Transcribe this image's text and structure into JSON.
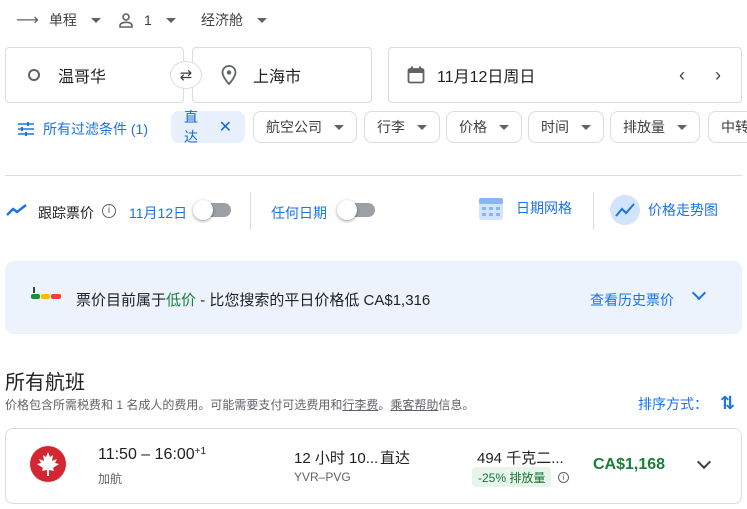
{
  "top_controls": {
    "trip_type": "单程",
    "passengers": "1",
    "cabin_class": "经济舱"
  },
  "search": {
    "origin": "温哥华",
    "destination": "上海市",
    "date": "11月12日周日"
  },
  "filters": {
    "all_filters": "所有过滤条件 (1)",
    "nonstop": "直达",
    "airlines": "航空公司",
    "bags": "行李",
    "price": "价格",
    "times": "时间",
    "emissions": "排放量",
    "overflow": "中转"
  },
  "tracking": {
    "label": "跟踪票价",
    "date": "11月12日",
    "any_dates": "任何日期",
    "date_grid": "日期网格",
    "price_graph": "价格走势图"
  },
  "price_insight": {
    "prefix": "票价目前属于",
    "level": "低价",
    "suffix": " - 比您搜索的平日价格低 CA$1,316",
    "history_link": "查看历史票价",
    "bar_colors": [
      "#1e8e3e",
      "#fbbc04",
      "#ea4335"
    ]
  },
  "results": {
    "heading": "所有航班",
    "note_part1": "价格包含所需税费和 1 名成人的费用。可能需要支付可选费用和",
    "note_link1": "行李费",
    "note_part2": "。",
    "note_link2": "乘客帮助",
    "note_part3": "信息。",
    "sort_label": "排序方式："
  },
  "flights": [
    {
      "times": "11:50 – 16:00",
      "day_offset": "+1",
      "airline": "加航",
      "duration": "12 小时 10...",
      "stops": "直达",
      "route": "YVR–PVG",
      "emissions": "494 千克二...",
      "emissions_badge": "-25% 排放量",
      "price": "CA$1,168",
      "airline_color": "#d22630",
      "price_color": "#188038"
    }
  ]
}
